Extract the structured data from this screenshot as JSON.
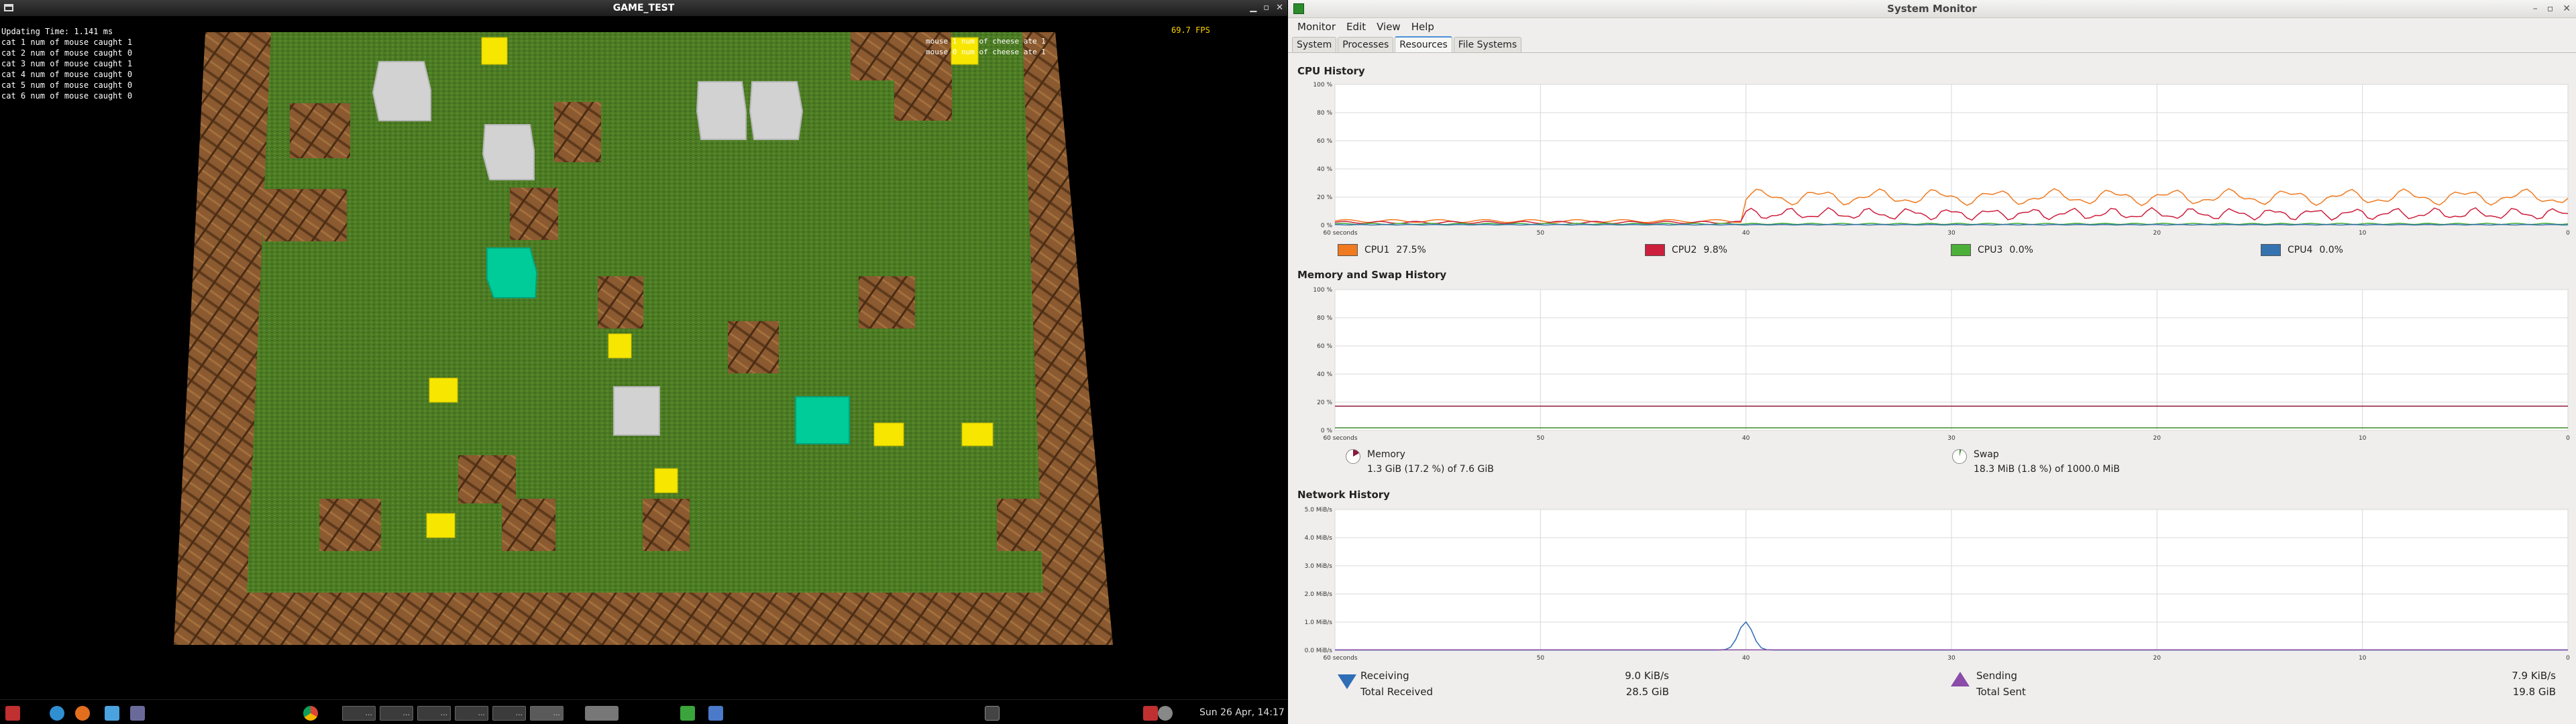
{
  "game": {
    "title": "GAME_TEST",
    "fps": "69.7 FPS",
    "status_lines": [
      "Updating Time: 1.141 ms",
      "cat 1 num of mouse caught 1",
      "cat 2 num of mouse caught 0",
      "cat 3 num of mouse caught 1",
      "cat 4 num of mouse caught 0",
      "cat 5 num of mouse caught 0",
      "cat 6 num of mouse caught 0"
    ],
    "mouse_lines": [
      "mouse 1 num of cheese ate 1",
      "mouse 0 num of cheese ate 1"
    ],
    "colors": {
      "grass": "#4a7a22",
      "wood": "#8a5a2e",
      "cheese": "#f4e400",
      "stone": "#d0d0d0",
      "teal": "#00c896"
    }
  },
  "monitor": {
    "title": "System Monitor",
    "menu": [
      "Monitor",
      "Edit",
      "View",
      "Help"
    ],
    "tabs": [
      "System",
      "Processes",
      "Resources",
      "File Systems"
    ],
    "active_tab": "Resources",
    "x_ticks": [
      "60 seconds",
      "50",
      "40",
      "30",
      "20",
      "10",
      "0"
    ],
    "cpu": {
      "heading": "CPU History",
      "y_ticks": [
        "100 %",
        "80 %",
        "60 %",
        "40 %",
        "20 %",
        "0 %"
      ],
      "legend": [
        {
          "label": "CPU1",
          "value": "27.5%",
          "color": "#f07a20"
        },
        {
          "label": "CPU2",
          "value": "9.8%",
          "color": "#cc1f3c"
        },
        {
          "label": "CPU3",
          "value": "0.0%",
          "color": "#4caf39"
        },
        {
          "label": "CPU4",
          "value": "0.0%",
          "color": "#3473b0"
        }
      ]
    },
    "memory": {
      "heading": "Memory and Swap History",
      "y_ticks": [
        "100 %",
        "80 %",
        "60 %",
        "40 %",
        "20 %",
        "0 %"
      ],
      "memory_label": "Memory",
      "memory_value": "1.3 GiB (17.2 %) of 7.6 GiB",
      "swap_label": "Swap",
      "swap_value": "18.3 MiB (1.8 %) of 1000.0 MiB",
      "memory_percent": 17.2,
      "swap_percent": 1.8
    },
    "network": {
      "heading": "Network History",
      "y_ticks": [
        "5.0 MiB/s",
        "4.0 MiB/s",
        "3.0 MiB/s",
        "2.0 MiB/s",
        "1.0 MiB/s",
        "0.0 MiB/s"
      ],
      "receiving_label": "Receiving",
      "receiving_value": "9.0 KiB/s",
      "total_received_label": "Total Received",
      "total_received_value": "28.5 GiB",
      "sending_label": "Sending",
      "sending_value": "7.9 KiB/s",
      "total_sent_label": "Total Sent",
      "total_sent_value": "19.8 GiB"
    }
  },
  "taskbar": {
    "clock": "Sun 26 Apr, 14:17",
    "window_button_label": "..."
  }
}
